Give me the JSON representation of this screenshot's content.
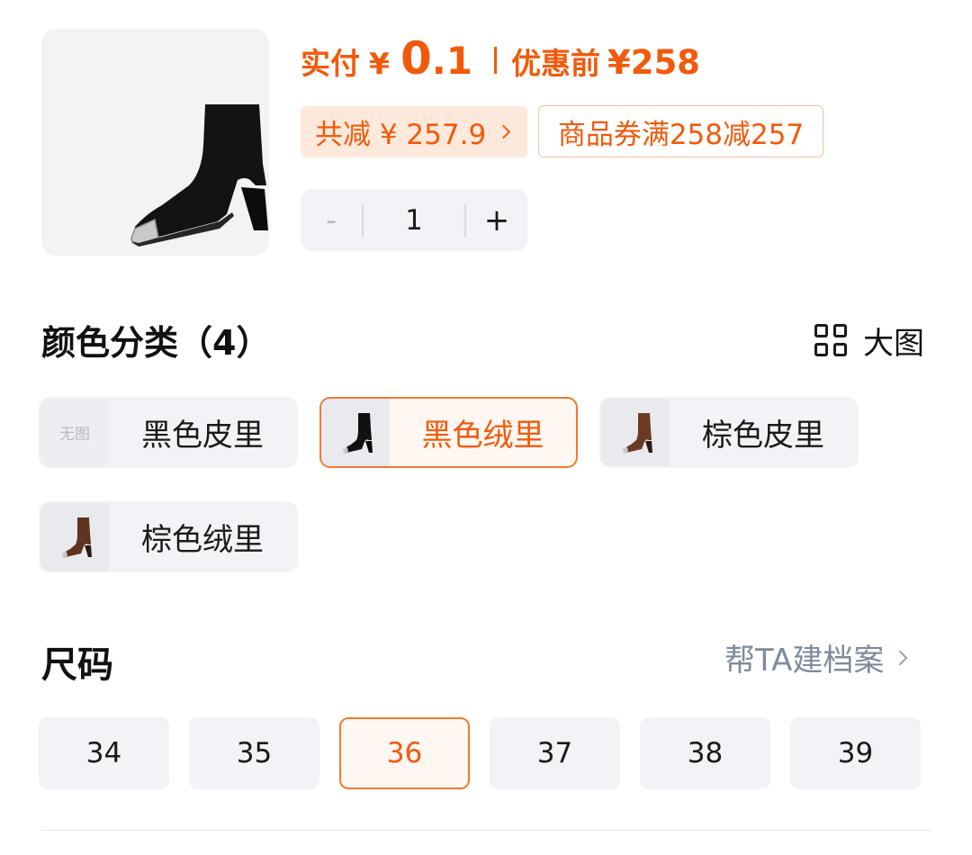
{
  "product": {
    "image_icon": "ankle-boot-black-suede"
  },
  "price": {
    "paid_label": "实付",
    "currency": "¥",
    "paid_int": "0",
    "paid_dec": ".1",
    "original_label": "优惠前",
    "original_value": "¥258"
  },
  "discount": {
    "saved_text": "共减 ¥ 257.9",
    "coupon_text": "商品券满258减257"
  },
  "quantity": {
    "minus": "-",
    "value": "1",
    "plus": "+"
  },
  "color_section": {
    "title": "颜色分类（4）",
    "view_large_label": "大图",
    "view_large_icon": "grid-icon",
    "no_image_text": "无图",
    "options": [
      {
        "label": "黑色皮里",
        "image": "none",
        "selected": false
      },
      {
        "label": "黑色绒里",
        "image": "black-boot",
        "selected": true
      },
      {
        "label": "棕色皮里",
        "image": "brown-boot",
        "selected": false
      },
      {
        "label": "棕色绒里",
        "image": "brown-boot",
        "selected": false
      }
    ]
  },
  "size_section": {
    "title": "尺码",
    "archive_label": "帮TA建档案",
    "sizes": [
      "34",
      "35",
      "36",
      "37",
      "38",
      "39"
    ],
    "selected": "36"
  },
  "colors": {
    "accent": "#f25a0b",
    "accent_border": "#f07a32",
    "chip_bg": "#fde9db",
    "option_bg": "#f1f3f6",
    "muted_text": "#7e8b9b"
  }
}
